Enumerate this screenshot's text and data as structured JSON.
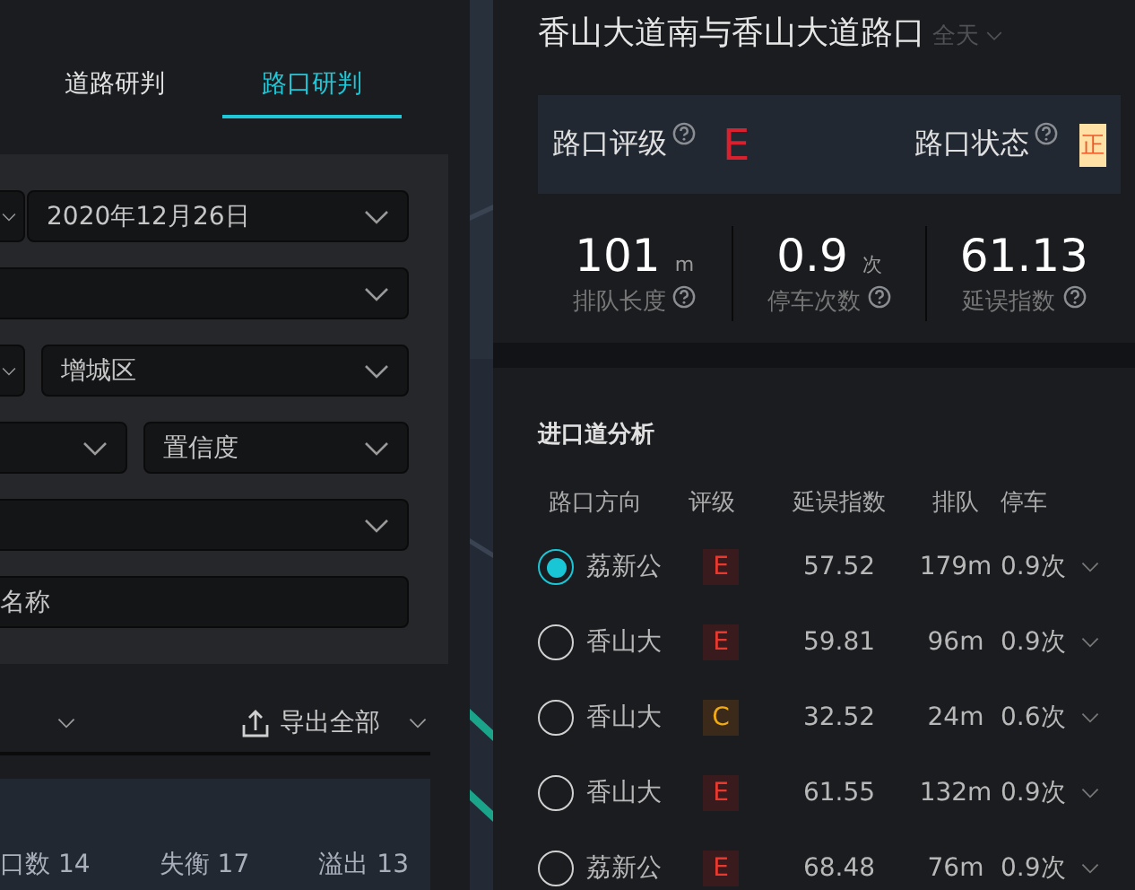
{
  "left_panel": {
    "tabs": [
      {
        "label": "道路研判",
        "selected": false
      },
      {
        "label": "路口研判",
        "selected": true
      }
    ],
    "filters": [
      {
        "kind": "cut_pair",
        "value": "2020年12月26日"
      },
      {
        "kind": "select"
      },
      {
        "kind": "cut_pair",
        "value": "增城区"
      },
      {
        "kind": "wide_pair",
        "value": "置信度"
      },
      {
        "kind": "select"
      },
      {
        "kind": "input",
        "placeholder": "名称"
      }
    ],
    "export_button": "导出全部",
    "stats": [
      "口数 14",
      "失衡 17",
      "溢出 13"
    ]
  },
  "detail": {
    "title": "香山大道南与香山大道路口",
    "period": "全天",
    "rating": {
      "label": "路口评级",
      "grade": "E",
      "status_label": "路口状态",
      "status": "正"
    },
    "metrics": [
      {
        "value": "101",
        "unit": "m",
        "label": "排队长度"
      },
      {
        "value": "0.9",
        "unit": "次",
        "label": "停车次数"
      },
      {
        "value": "61.13",
        "label": "延误指数"
      }
    ]
  },
  "approach_analysis": {
    "title": "进口道分析",
    "columns": [
      "路口方向",
      "评级",
      "延误指数",
      "排队",
      "停车"
    ],
    "rows": [
      {
        "direction": "荔新公",
        "grade": "E",
        "delay": "57.52",
        "queue": "179m",
        "stops": "0.9次",
        "selected": true
      },
      {
        "direction": "香山大",
        "grade": "E",
        "delay": "59.81",
        "queue": "96m",
        "stops": "0.9次",
        "selected": false
      },
      {
        "direction": "香山大",
        "grade": "C",
        "delay": "32.52",
        "queue": "24m",
        "stops": "0.6次",
        "selected": false
      },
      {
        "direction": "香山大",
        "grade": "E",
        "delay": "61.55",
        "queue": "132m",
        "stops": "0.9次",
        "selected": false
      },
      {
        "direction": "荔新公",
        "grade": "E",
        "delay": "68.48",
        "queue": "76m",
        "stops": "0.9次",
        "selected": false
      }
    ]
  }
}
